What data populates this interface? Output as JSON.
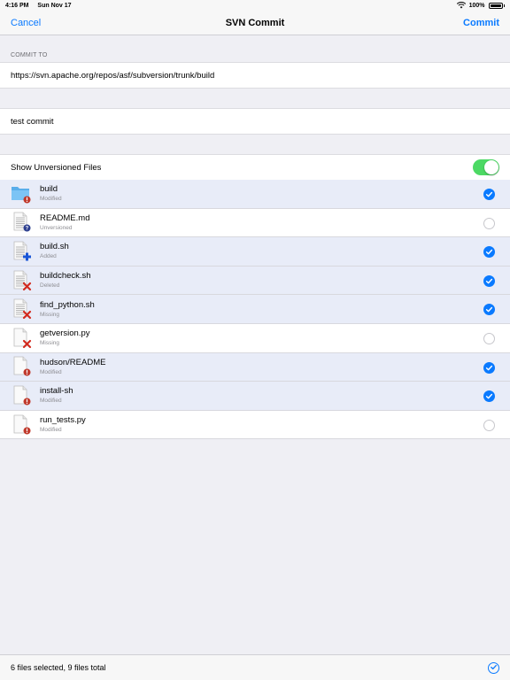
{
  "status_bar": {
    "time": "4:16 PM",
    "date": "Sun Nov 17",
    "battery": "100%"
  },
  "nav": {
    "cancel_label": "Cancel",
    "title": "SVN Commit",
    "commit_label": "Commit"
  },
  "commit_to": {
    "header": "COMMIT TO",
    "url": "https://svn.apache.org/repos/asf/subversion/trunk/build"
  },
  "message": {
    "text": "test commit"
  },
  "unversioned_toggle": {
    "label": "Show Unversioned Files",
    "on": true,
    "color": "#4cd964"
  },
  "files": [
    {
      "name": "build",
      "status": "Modified",
      "selected": true,
      "icon": "folder-icon",
      "badge": "modified-badge-icon"
    },
    {
      "name": "README.md",
      "status": "Unversioned",
      "selected": false,
      "icon": "text-file-icon",
      "badge": "unversioned-badge-icon"
    },
    {
      "name": "build.sh",
      "status": "Added",
      "selected": true,
      "icon": "text-file-icon",
      "badge": "added-badge-icon"
    },
    {
      "name": "buildcheck.sh",
      "status": "Deleted",
      "selected": true,
      "icon": "text-file-icon",
      "badge": "deleted-badge-icon"
    },
    {
      "name": "find_python.sh",
      "status": "Missing",
      "selected": true,
      "icon": "text-file-icon",
      "badge": "missing-badge-icon"
    },
    {
      "name": "getversion.py",
      "status": "Missing",
      "selected": false,
      "icon": "blank-file-icon",
      "badge": "missing-badge-icon"
    },
    {
      "name": "hudson/README",
      "status": "Modified",
      "selected": true,
      "icon": "blank-file-icon",
      "badge": "modified-badge-icon"
    },
    {
      "name": "install-sh",
      "status": "Modified",
      "selected": true,
      "icon": "blank-file-icon",
      "badge": "modified-badge-icon"
    },
    {
      "name": "run_tests.py",
      "status": "Modified",
      "selected": false,
      "icon": "blank-file-icon",
      "badge": "modified-badge-icon"
    }
  ],
  "footer": {
    "summary": "6 files selected, 9 files total"
  },
  "colors": {
    "accent": "#0a7aff",
    "selected_row": "#e8ecf8",
    "modified": "#c0392b",
    "added": "#1a56d6",
    "deleted": "#d22a1e",
    "unversioned": "#2c3e8f"
  }
}
